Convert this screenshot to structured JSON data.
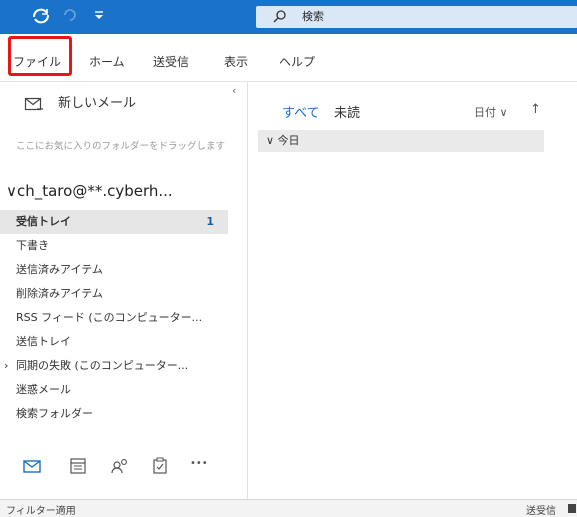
{
  "titlebar": {
    "search_text": "検索",
    "accent": "#1a73c8"
  },
  "menu": {
    "file": "ファイル",
    "home": "ホーム",
    "send_receive": "送受信",
    "view": "表示",
    "help": "ヘルプ",
    "highlight_color": "#e8151b"
  },
  "nav": {
    "new_mail": "新しいメール",
    "collapse_glyph": "‹",
    "favorites_hint": "ここにお気に入りのフォルダーをドラッグします",
    "account": "ch_taro@**.cyberh...",
    "folders": [
      {
        "label": "受信トレイ",
        "count": "1"
      },
      {
        "label": "下書き"
      },
      {
        "label": "送信済みアイテム"
      },
      {
        "label": "削除済みアイテム"
      },
      {
        "label": "RSS フィード (このコンピューター..."
      },
      {
        "label": "送信トレイ"
      },
      {
        "label": "同期の失敗 (このコンピューター..."
      },
      {
        "label": "迷惑メール"
      },
      {
        "label": "検索フォルダー"
      }
    ],
    "modules": [
      "mail-icon",
      "calendar-icon",
      "people-icon",
      "tasks-icon",
      "more-icon"
    ],
    "more_glyph": "•••"
  },
  "list": {
    "tab_all": "すべて",
    "tab_unread": "未読",
    "sort_label": "日付 ∨",
    "sort_direction": "↑",
    "group_label": "∨ 今日"
  },
  "status": {
    "left": "フィルター適用",
    "right": "送受信"
  }
}
